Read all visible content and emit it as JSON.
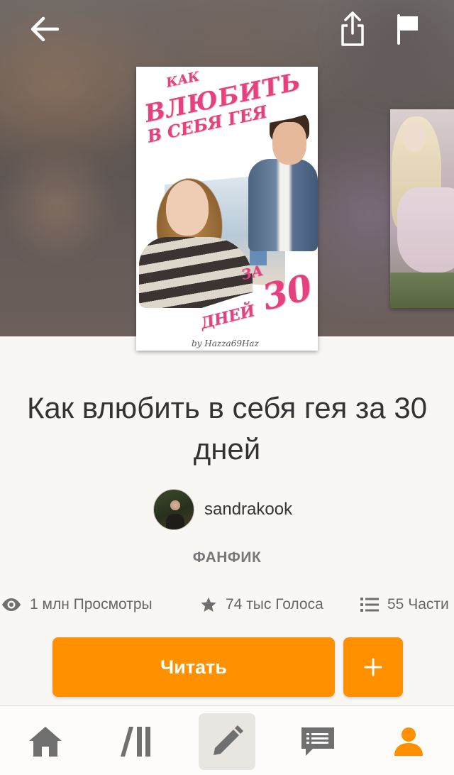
{
  "header": {
    "back_icon": "arrow-left-icon",
    "share_icon": "share-icon",
    "report_icon": "flag-icon"
  },
  "cover": {
    "title_lines": [
      "КАК",
      "ВЛЮБИТЬ",
      "В СЕБЯ ГЕЯ",
      "ЗА",
      "30",
      "ДНЕЙ"
    ],
    "byline": "by Hazza69Haz"
  },
  "story": {
    "title": "Как влюбить в себя гея за 30 дней",
    "author": "sandrakook",
    "category": "ФАНФИК"
  },
  "stats": {
    "views": "1 млн Просмотры",
    "votes": "74 тыс Голоса",
    "parts": "55 Части"
  },
  "actions": {
    "read_label": "Читать",
    "add_label": "+"
  },
  "bottom_nav": {
    "items": [
      {
        "icon": "home-icon",
        "active": false
      },
      {
        "icon": "library-icon",
        "active": false
      },
      {
        "icon": "pencil-icon",
        "active": false,
        "highlighted": true
      },
      {
        "icon": "messages-icon",
        "active": false
      },
      {
        "icon": "profile-icon",
        "active": true
      }
    ]
  },
  "colors": {
    "accent": "#ff9100",
    "icon_gray": "#6f6f6f",
    "background": "#f9f7f4"
  }
}
